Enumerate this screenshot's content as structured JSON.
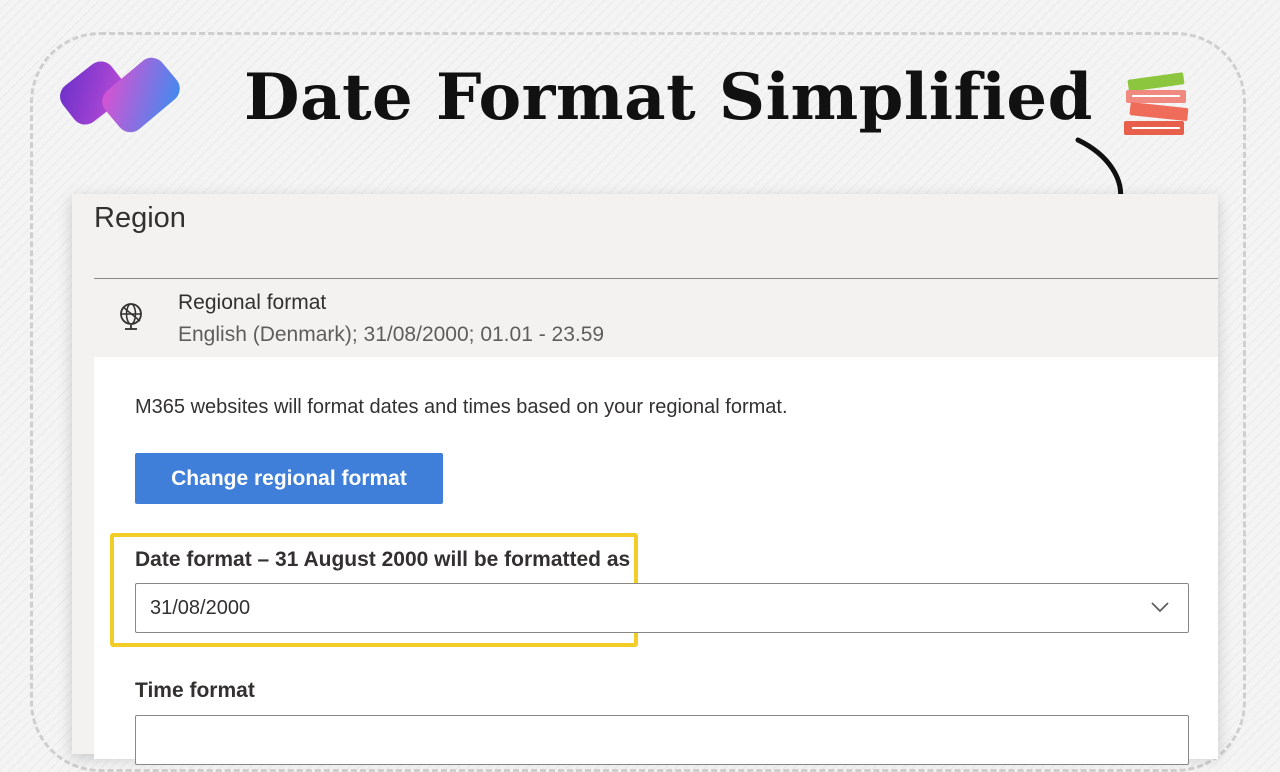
{
  "banner": {
    "title": "Date Format Simplified",
    "icons": [
      "copilot-logo-icon",
      "books-icon",
      "curved-arrow-icon"
    ]
  },
  "panel": {
    "title": "Region",
    "regional_format": {
      "icon": "globe-icon",
      "title": "Regional format",
      "summary": "English (Denmark); 31/08/2000; 01.01 - 23.59"
    },
    "description": "M365 websites will format dates and times based on your regional format.",
    "change_button": "Change regional format",
    "date_format": {
      "label": "Date format – 31 August 2000 will be formatted as",
      "value": "31/08/2000"
    },
    "time_format": {
      "label": "Time format",
      "value": ""
    }
  },
  "colors": {
    "button": "#3f7fd9",
    "highlight": "#f2cd28",
    "panel_bg": "#f3f2f1"
  }
}
